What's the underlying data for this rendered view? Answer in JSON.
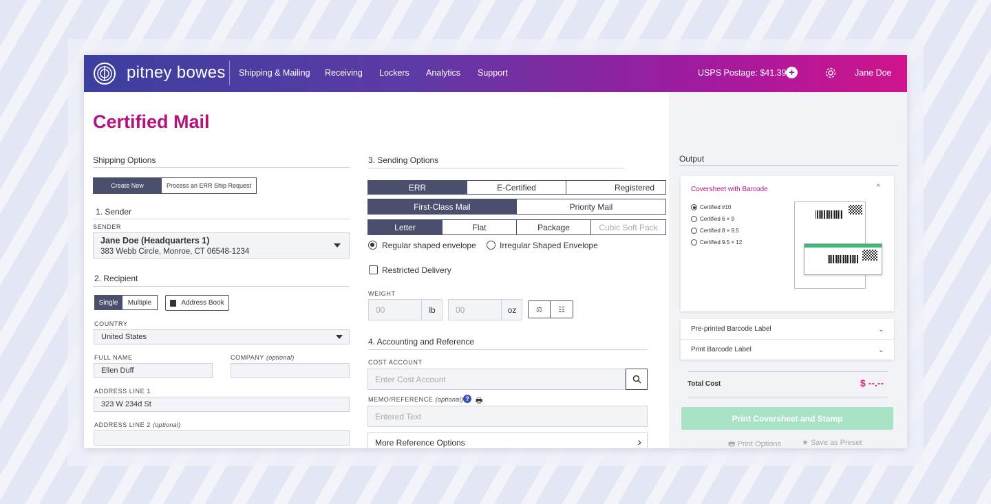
{
  "nav": {
    "brand": "pitney bowes",
    "items": [
      "Shipping & Mailing",
      "Receiving",
      "Lockers",
      "Analytics",
      "Support"
    ],
    "postage": "USPS Postage: $41.39",
    "user": "Jane Doe"
  },
  "page": {
    "title": "Certified Mail"
  },
  "shipping": {
    "heading": "Shipping Options",
    "create_new": "Create New",
    "process_err": "Process an ERR Ship Request"
  },
  "sender": {
    "heading": "1. Sender",
    "label": "SENDER",
    "name": "Jane Doe (Headquarters 1)",
    "address": "383 Webb Circle, Monroe, CT 06548-1234"
  },
  "recipient": {
    "heading": "2. Recipient",
    "single": "Single",
    "multiple": "Multiple",
    "address_book": "Address Book",
    "country_label": "COUNTRY",
    "country": "United States",
    "full_name_label": "FULL NAME",
    "full_name": "Ellen Duff",
    "company_label": "COMPANY",
    "optional": "(optional)",
    "address1_label": "ADDRESS LINE 1",
    "address1": "323 W 234d St",
    "address2_label": "ADDRESS LINE 2"
  },
  "sending": {
    "heading": "3. Sending Options",
    "service_types": [
      "ERR",
      "E-Certified",
      "Registered"
    ],
    "mail_classes": [
      "First-Class Mail",
      "Priority Mail"
    ],
    "packages": [
      "Letter",
      "Flat",
      "Package",
      "Cubic Soft Pack"
    ],
    "regular_envelope": "Regular shaped envelope",
    "irregular_envelope": "Irregular Shaped Envelope",
    "restricted": "Restricted Delivery",
    "weight_label": "WEIGHT",
    "lb_placeholder": "00",
    "lb_unit": "lb",
    "oz_placeholder": "00",
    "oz_unit": "oz"
  },
  "accounting": {
    "heading": "4. Accounting and Reference",
    "cost_label": "COST ACCOUNT",
    "cost_placeholder": "Enter Cost Account",
    "memo_label": "MEMO/REFERENCE",
    "optional": "(optional)",
    "memo_placeholder": "Entered Text",
    "more_options": "More Reference Options"
  },
  "output": {
    "heading": "Output",
    "coversheet_title": "Coversheet with Barcode",
    "coversheet_options": [
      "Certified #10",
      "Certified 6 × 9",
      "Certified 8 × 9.5",
      "Certified 9.5 × 12"
    ],
    "preprinted": "Pre-printed Barcode Label",
    "print_label": "Print Barcode Label",
    "total_label": "Total Cost",
    "total_value": "$ --.--",
    "print_button": "Print Coversheet and Stamp",
    "print_options": "Print Options",
    "save_preset": "Save as Preset"
  },
  "colors": {
    "accent": "#b4127f",
    "segment_active": "#4a4f6e",
    "print_button": "#a9e3c5"
  }
}
